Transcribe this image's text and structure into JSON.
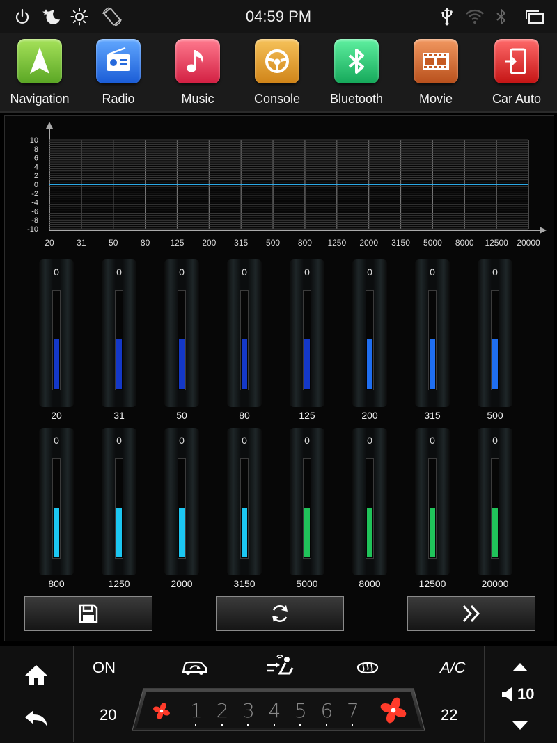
{
  "status_bar": {
    "time": "04:59 PM",
    "icons": [
      "power-icon",
      "night-mode-icon",
      "brightness-icon",
      "rotate-icon",
      "usb-icon",
      "wifi-icon",
      "bluetooth-status-icon",
      "recent-apps-icon"
    ]
  },
  "apps": [
    {
      "label": "Navigation",
      "icon": "navigation-icon",
      "color": "#7cc43a"
    },
    {
      "label": "Radio",
      "icon": "radio-icon",
      "color": "#2f7fe8"
    },
    {
      "label": "Music",
      "icon": "music-icon",
      "color": "#e63c5a"
    },
    {
      "label": "Console",
      "icon": "steering-wheel-icon",
      "color": "#e2a030"
    },
    {
      "label": "Bluetooth",
      "icon": "bluetooth-icon",
      "color": "#22c070"
    },
    {
      "label": "Movie",
      "icon": "film-icon",
      "color": "#c0622c"
    },
    {
      "label": "Car Auto",
      "icon": "phone-mirror-icon",
      "color": "#dd2a2a"
    }
  ],
  "equalizer": {
    "graph": {
      "y_ticks": [
        "10",
        "8",
        "6",
        "4",
        "2",
        "0",
        "-2",
        "-4",
        "-6",
        "-8",
        "-10"
      ],
      "x_ticks": [
        "20",
        "31",
        "50",
        "80",
        "125",
        "200",
        "315",
        "500",
        "800",
        "1250",
        "2000",
        "3150",
        "5000",
        "8000",
        "12500",
        "20000"
      ],
      "line_color": "#2aa8e6",
      "curve_values": [
        0,
        0,
        0,
        0,
        0,
        0,
        0,
        0,
        0,
        0,
        0,
        0,
        0,
        0,
        0,
        0
      ]
    },
    "row1": [
      {
        "freq": "20",
        "value": "0",
        "level": 0.5,
        "color": "#1438c8"
      },
      {
        "freq": "31",
        "value": "0",
        "level": 0.5,
        "color": "#1438c8"
      },
      {
        "freq": "50",
        "value": "0",
        "level": 0.5,
        "color": "#1438c8"
      },
      {
        "freq": "80",
        "value": "0",
        "level": 0.5,
        "color": "#1438c8"
      },
      {
        "freq": "125",
        "value": "0",
        "level": 0.5,
        "color": "#1438c8"
      },
      {
        "freq": "200",
        "value": "0",
        "level": 0.5,
        "color": "#1f6ef0"
      },
      {
        "freq": "315",
        "value": "0",
        "level": 0.5,
        "color": "#1f6ef0"
      },
      {
        "freq": "500",
        "value": "0",
        "level": 0.5,
        "color": "#1f6ef0"
      }
    ],
    "row2": [
      {
        "freq": "800",
        "value": "0",
        "level": 0.5,
        "color": "#1cc7f2"
      },
      {
        "freq": "1250",
        "value": "0",
        "level": 0.5,
        "color": "#1cc7f2"
      },
      {
        "freq": "2000",
        "value": "0",
        "level": 0.5,
        "color": "#1cc7f2"
      },
      {
        "freq": "3150",
        "value": "0",
        "level": 0.5,
        "color": "#1cc7f2"
      },
      {
        "freq": "5000",
        "value": "0",
        "level": 0.5,
        "color": "#20c35a"
      },
      {
        "freq": "8000",
        "value": "0",
        "level": 0.5,
        "color": "#20c35a"
      },
      {
        "freq": "12500",
        "value": "0",
        "level": 0.5,
        "color": "#20c35a"
      },
      {
        "freq": "20000",
        "value": "0",
        "level": 0.5,
        "color": "#20c35a"
      }
    ],
    "buttons": [
      "save-icon",
      "reset-icon",
      "next-icon"
    ]
  },
  "climate": {
    "power": "ON",
    "ac": "A/C",
    "temp_left": "20",
    "temp_right": "22",
    "fan_levels": [
      "1",
      "2",
      "3",
      "4",
      "5",
      "6",
      "7"
    ],
    "fan_color": "#ff3b2a"
  },
  "volume": {
    "value": "10"
  }
}
